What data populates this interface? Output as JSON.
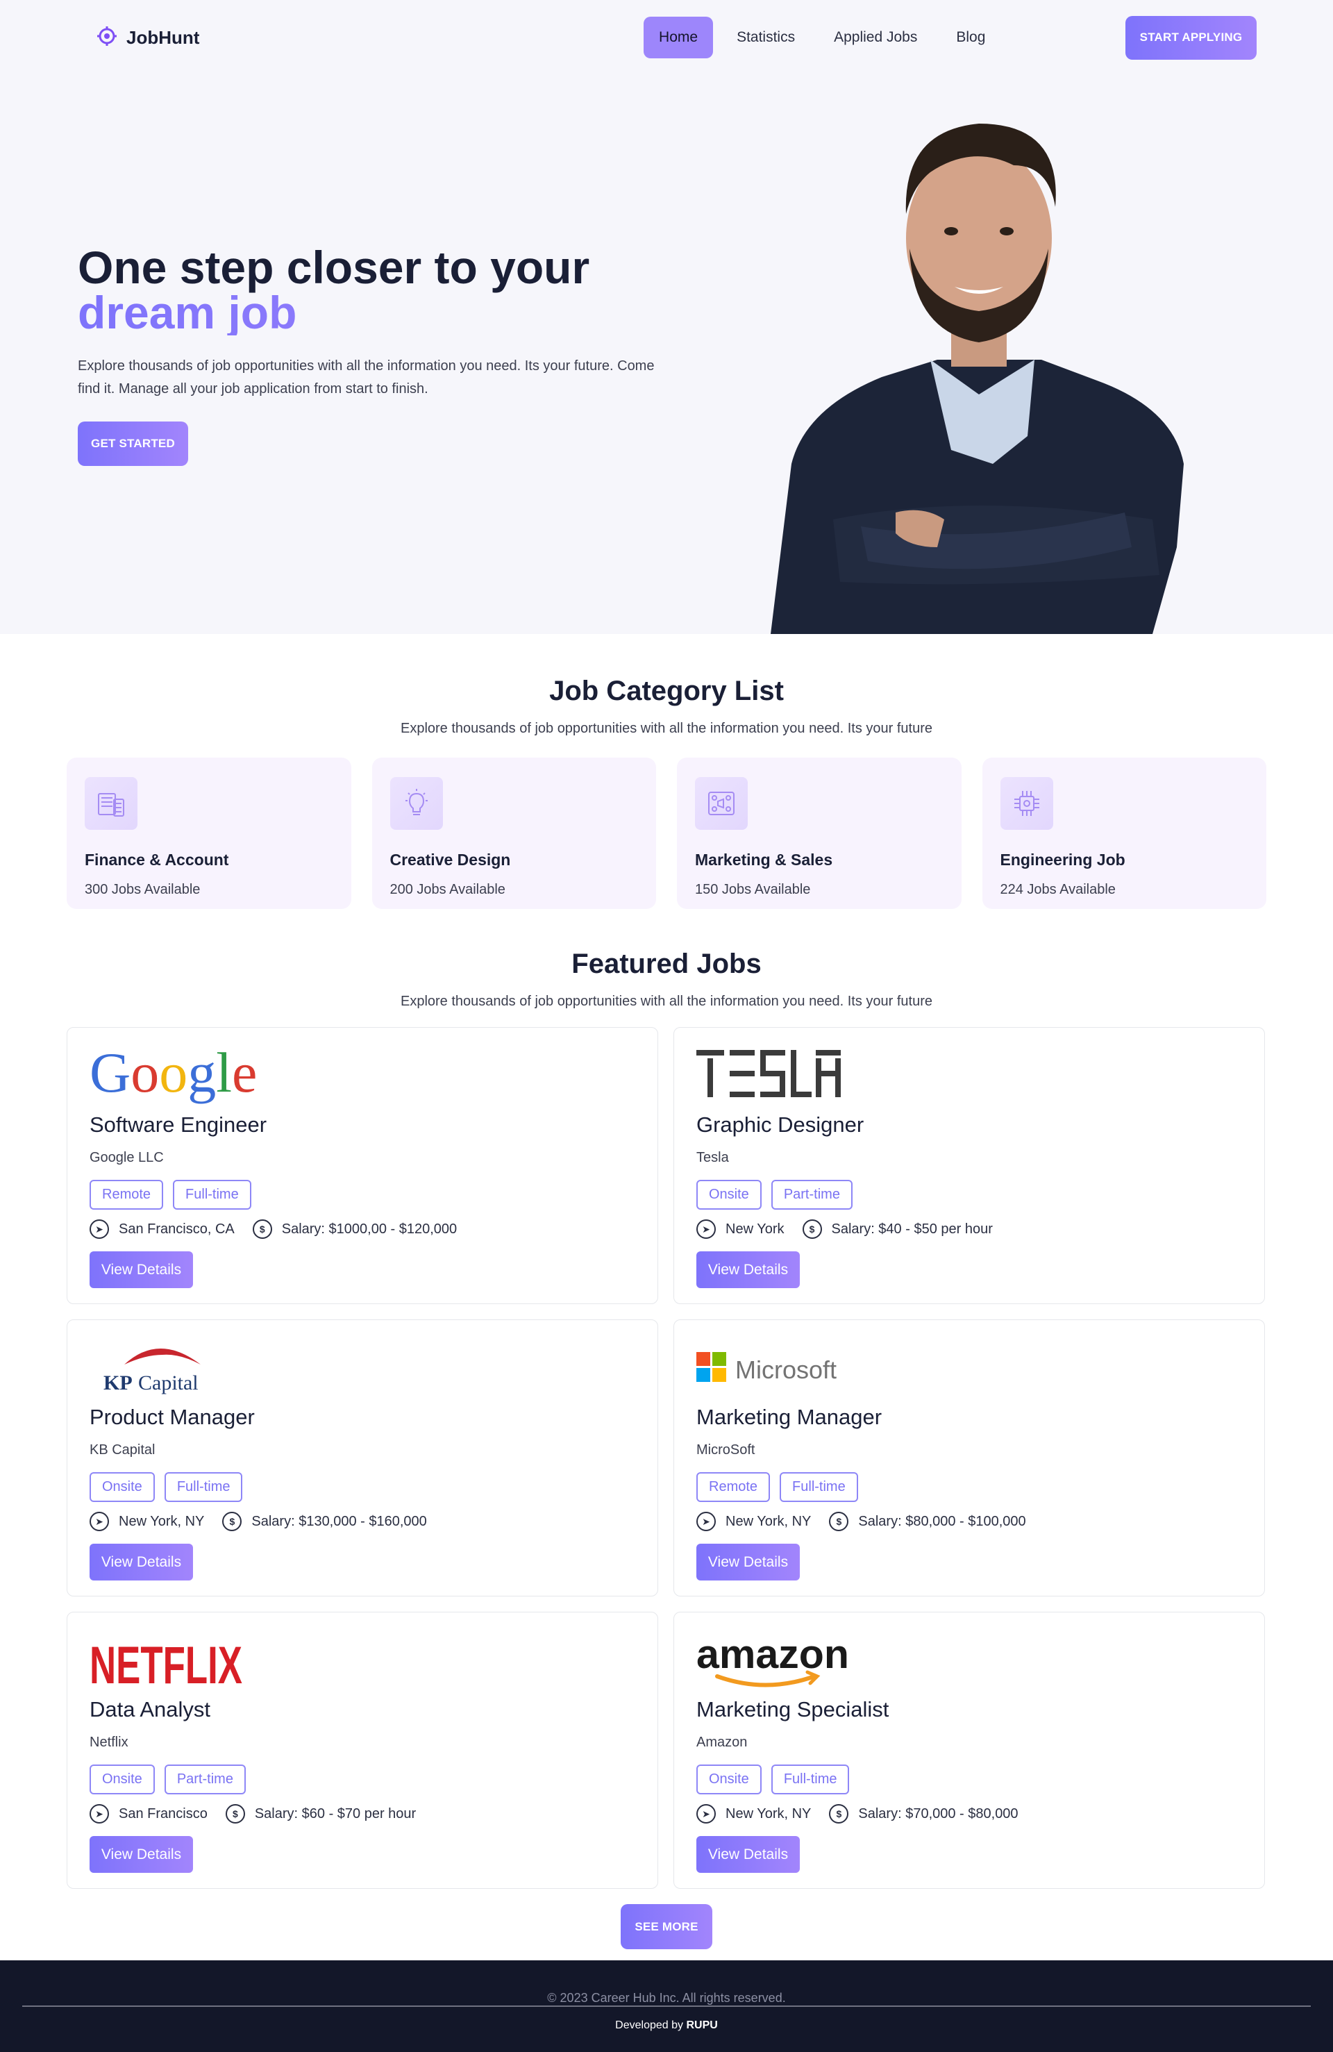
{
  "nav": {
    "brand": "JobHunt",
    "links": [
      "Home",
      "Statistics",
      "Applied Jobs",
      "Blog"
    ],
    "active": "Home",
    "cta": "START APPLYING"
  },
  "hero": {
    "title_line1": "One step closer to your",
    "title_accent": "dream job",
    "description": "Explore thousands of job opportunities with all the information you need. Its your future. Come find it. Manage all your job application from start to finish.",
    "button": "GET STARTED"
  },
  "categories": {
    "title": "Job Category List",
    "subtitle": "Explore thousands of job opportunities with all the information you need. Its your future",
    "items": [
      {
        "name": "Finance & Account",
        "count": "300 Jobs Available",
        "icon": "finance-icon"
      },
      {
        "name": "Creative Design",
        "count": "200 Jobs Available",
        "icon": "lightbulb-icon"
      },
      {
        "name": "Marketing & Sales",
        "count": "150 Jobs Available",
        "icon": "marketing-icon"
      },
      {
        "name": "Engineering Job",
        "count": "224 Jobs Available",
        "icon": "chip-icon"
      }
    ]
  },
  "featured": {
    "title": "Featured Jobs",
    "subtitle": "Explore thousands of job opportunities with all the information you need. Its your future",
    "jobs": [
      {
        "logo": "Google",
        "title": "Software Engineer",
        "company": "Google LLC",
        "tags": [
          "Remote",
          "Full-time"
        ],
        "location": "San Francisco, CA",
        "salary": "Salary: $1000,00 - $120,000",
        "button": "View Details"
      },
      {
        "logo": "TESLA",
        "title": "Graphic Designer",
        "company": "Tesla",
        "tags": [
          "Onsite",
          "Part-time"
        ],
        "location": "New York",
        "salary": "Salary: $40 - $50 per hour",
        "button": "View Details"
      },
      {
        "logo": "KPCapital",
        "title": "Product Manager",
        "company": "KB Capital",
        "tags": [
          "Onsite",
          "Full-time"
        ],
        "location": "New York, NY",
        "salary": "Salary: $130,000 - $160,000",
        "button": "View Details"
      },
      {
        "logo": "Microsoft",
        "title": "Marketing Manager",
        "company": "MicroSoft",
        "tags": [
          "Remote",
          "Full-time"
        ],
        "location": "New York, NY",
        "salary": "Salary: $80,000 - $100,000",
        "button": "View Details"
      },
      {
        "logo": "NETFLIX",
        "title": "Data Analyst",
        "company": "Netflix",
        "tags": [
          "Onsite",
          "Part-time"
        ],
        "location": "San Francisco",
        "salary": "Salary: $60 - $70 per hour",
        "button": "View Details"
      },
      {
        "logo": "amazon",
        "title": "Marketing Specialist",
        "company": "Amazon",
        "tags": [
          "Onsite",
          "Full-time"
        ],
        "location": "New York, NY",
        "salary": "Salary: $70,000 - $80,000",
        "button": "View Details"
      }
    ],
    "see_more": "SEE MORE"
  },
  "footer": {
    "copyright": "© 2023 Career Hub Inc. All rights reserved.",
    "developed_prefix": "Developed by",
    "developer": "RUPU"
  },
  "colors": {
    "accent_start": "#7e73fb",
    "accent_end": "#a285fc",
    "hero_bg": "#f6f6fb",
    "category_bg": "#f8f3fe",
    "footer_bg": "#131729"
  }
}
